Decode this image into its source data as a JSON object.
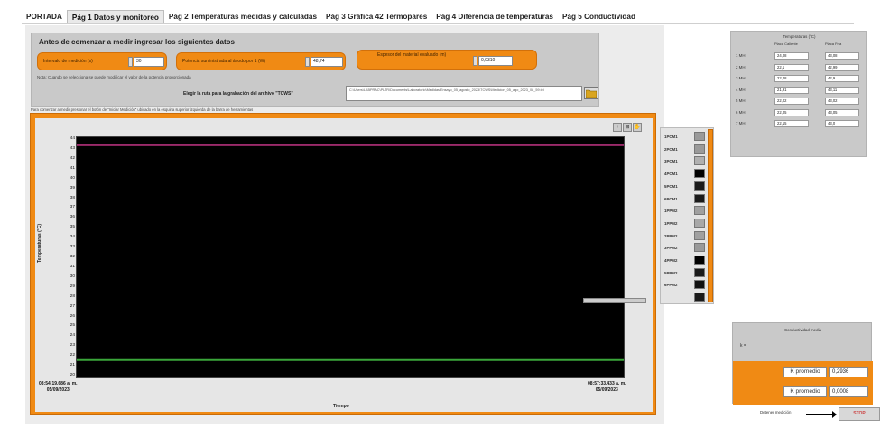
{
  "tabs": [
    {
      "label": "PORTADA",
      "active": false
    },
    {
      "label": "Pág 1 Datos y monitoreo",
      "active": true
    },
    {
      "label": "Pág 2 Temperaturas medidas y calculadas",
      "active": false
    },
    {
      "label": "Pág 3 Gráfica 42 Termopares",
      "active": false
    },
    {
      "label": "Pág 4 Diferencia de temperaturas",
      "active": false
    },
    {
      "label": "Pág 5 Conductividad",
      "active": false
    }
  ],
  "setup": {
    "title": "Antes de comenzar a medir ingresar los siguientes datos",
    "fields": [
      {
        "label": "Intervalo de medición (s)",
        "value": "30"
      },
      {
        "label": "Potencia suministrada al ánodo por 1 (W)",
        "value": "48,74"
      },
      {
        "label": "Espesor del material evaluado (m)",
        "value": "0,0310"
      }
    ],
    "note": "Nota: Cuando se selecciona se puede modificar el valor de la potencia proporcionada",
    "folder_label": "Elegir la ruta para la grabación del archivo \"TCWS\"",
    "path": "C:\\Users\\LABPRAC\\PLTR\\Documents\\Laboratorio\\Medidas\\Ensayo_05_agosto_2023\\TCWS\\Medicion_05_ago_2023_08_59.txt"
  },
  "warning_text": "Para comenzar a medir presionar el botón de \"Iniciar Medición\" ubicado en la esquina superior izquierda de la barra de herramientas",
  "chart_data": {
    "type": "line",
    "ylabel": "Temperaturas (°C)",
    "xlabel": "Tiempo",
    "y_ticks": [
      "44",
      "43",
      "42",
      "41",
      "40",
      "39",
      "38",
      "37",
      "36",
      "35",
      "34",
      "33",
      "32",
      "31",
      "30",
      "29",
      "28",
      "27",
      "26",
      "25",
      "24",
      "23",
      "22",
      "21",
      "20"
    ],
    "ylim": [
      20,
      44
    ],
    "x_start": [
      "08:54:19.686 a. m.",
      "05/09/2023"
    ],
    "x_end": [
      "08:57:33.433 a. m.",
      "05/09/2023"
    ],
    "series": [
      {
        "name": "",
        "color": "#9b2a6a",
        "values": [
          43.2,
          43.2
        ]
      },
      {
        "name": "",
        "color": "#3aa63a",
        "values": [
          21.9,
          21.9
        ]
      }
    ],
    "grid": false
  },
  "legend": {
    "items": [
      {
        "name": "1PCM1",
        "color": "#9a9a9a"
      },
      {
        "name": "2PCM1",
        "color": "#9a9a9a"
      },
      {
        "name": "3PCM1",
        "color": "#b0b0b0"
      },
      {
        "name": "4PCM1",
        "color": "#000000"
      },
      {
        "name": "5PCM1",
        "color": "#1a1a1a"
      },
      {
        "name": "6PCM1",
        "color": "#1a1a1a"
      },
      {
        "name": "1PPM2",
        "color": "#a0a0a0"
      },
      {
        "name": "1PPM2",
        "color": "#a8a8a8"
      },
      {
        "name": "2PPM2",
        "color": "#a0a0a0"
      },
      {
        "name": "3PPM2",
        "color": "#9a9a9a"
      },
      {
        "name": "4PPM2",
        "color": "#000000"
      },
      {
        "name": "5PPM2",
        "color": "#1a1a1a"
      },
      {
        "name": "6PPM2",
        "color": "#111111"
      },
      {
        "name": "",
        "color": "#1a1a1a"
      }
    ]
  },
  "temptable": {
    "title": "Temperaturas (°C)",
    "col1": "Placa Caliente",
    "col2": "Placa Fría",
    "rows": [
      {
        "label": "1 MH",
        "a": "24,08",
        "b": "43,08"
      },
      {
        "label": "2 MH",
        "a": "22,1",
        "b": "42,99"
      },
      {
        "label": "3 MH",
        "a": "22,08",
        "b": "42,9"
      },
      {
        "label": "4 MH",
        "a": "21,91",
        "b": "43,11"
      },
      {
        "label": "5 MH",
        "a": "22,02",
        "b": "43,02"
      },
      {
        "label": "6 MH",
        "a": "22,05",
        "b": "43,05"
      },
      {
        "label": "7 MH",
        "a": "22,15",
        "b": "43,0"
      }
    ]
  },
  "average": {
    "title": "Conductividad media",
    "k_label": "k =",
    "rows": [
      {
        "label": "K promedio",
        "value": "0,2936"
      },
      {
        "label": "K promedio",
        "value": "0,0008"
      }
    ]
  },
  "stop": {
    "hint": "Detener medición",
    "label": "STOP"
  }
}
